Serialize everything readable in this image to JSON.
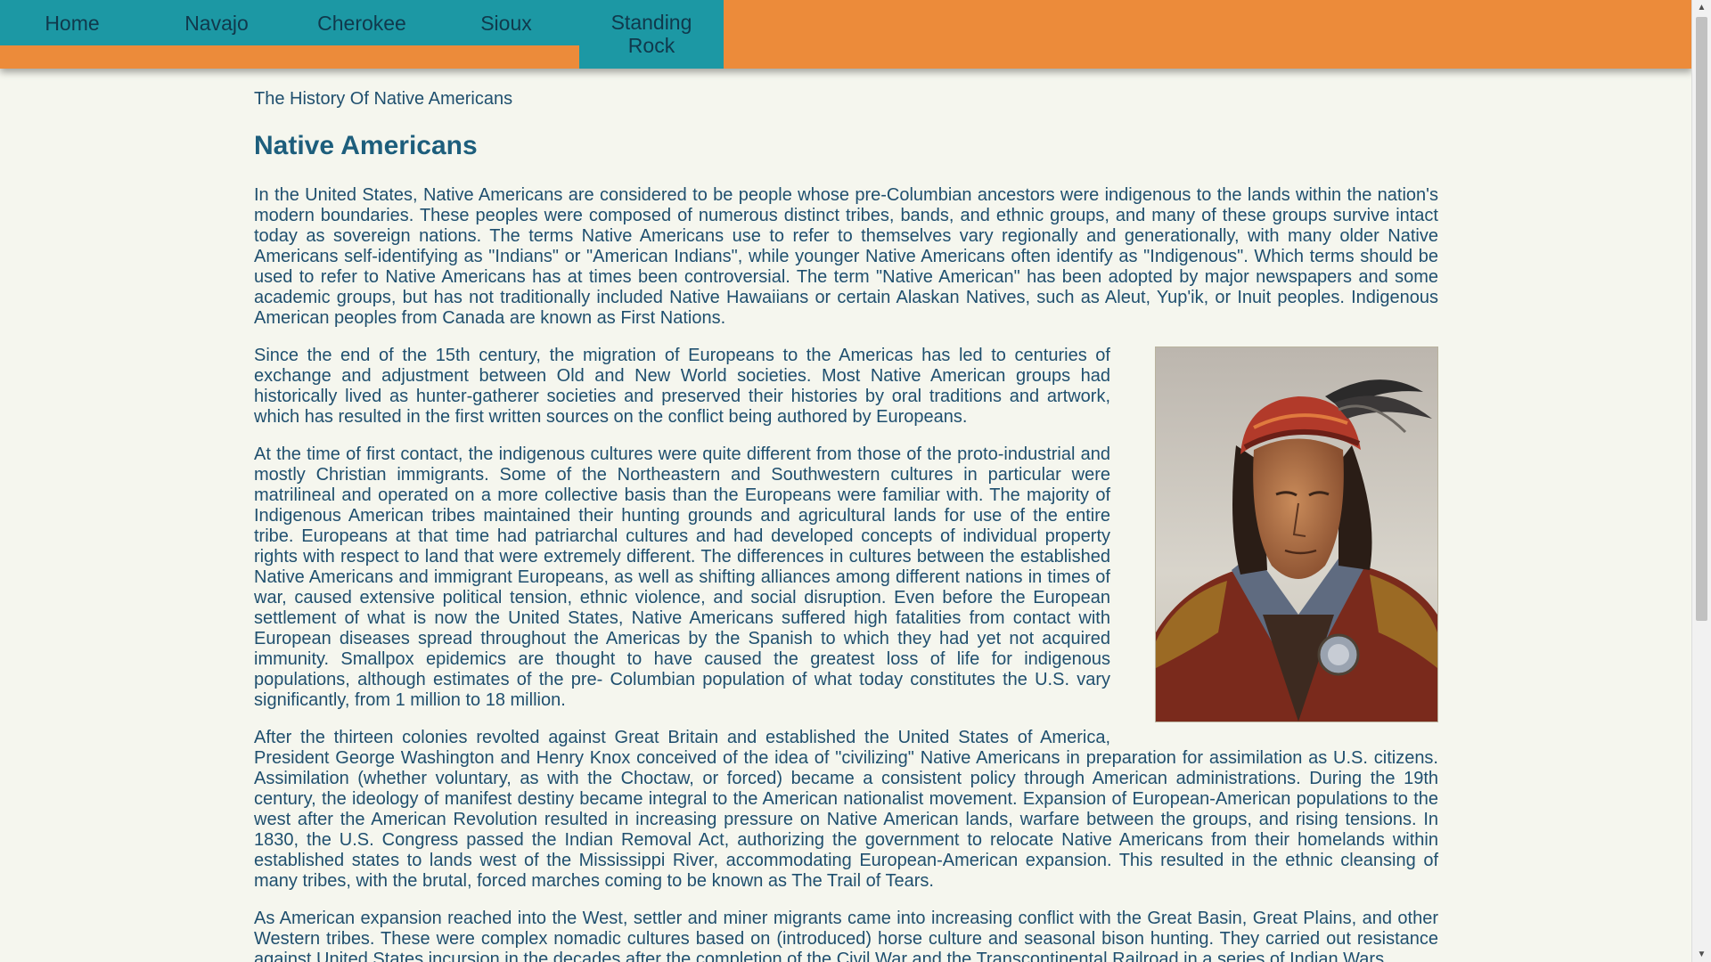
{
  "nav": {
    "items": [
      {
        "label": "Home"
      },
      {
        "label": "Navajo"
      },
      {
        "label": "Cherokee"
      },
      {
        "label": "Sioux"
      },
      {
        "label": "Standing Rock"
      }
    ]
  },
  "main": {
    "breadcrumb": "The History Of Native Americans",
    "title": "Native Americans",
    "paragraphs": [
      "In the United States, Native Americans are considered to be people whose pre-Columbian ancestors were indigenous to the lands within the nation's modern boundaries. These peoples were composed of numerous distinct tribes, bands, and ethnic groups, and many of these groups survive intact today as sovereign nations. The terms Native Americans use to refer to themselves vary regionally and generationally, with many older Native Americans self-identifying as \"Indians\" or \"American Indians\", while younger Native Americans often identify as \"Indigenous\". Which terms should be used to refer to Native Americans has at times been controversial. The term \"Native American\" has been adopted by major newspapers and some academic groups, but has not traditionally included Native Hawaiians or certain Alaskan Natives, such as Aleut, Yup'ik, or Inuit peoples. Indigenous American peoples from Canada are known as First Nations.",
      "Since the end of the 15th century, the migration of Europeans to the Americas has led to centuries of exchange and adjustment between Old and New World societies. Most Native American groups had historically lived as hunter-gatherer societies and preserved their histories by oral traditions and artwork, which has resulted in the first written sources on the conflict being authored by Europeans.",
      "At the time of first contact, the indigenous cultures were quite different from those of the proto-industrial and mostly Christian immigrants. Some of the Northeastern and Southwestern cultures in particular were matrilineal and operated on a more collective basis than the Europeans were familiar with. The majority of Indigenous American tribes maintained their hunting grounds and agricultural lands for use of the entire tribe. Europeans at that time had patriarchal cultures and had developed concepts of individual property rights with respect to land that were extremely different. The differences in cultures between the established Native Americans and immigrant Europeans, as well as shifting alliances among different nations in times of war, caused extensive political tension, ethnic violence, and social disruption. Even before the European settlement of what is now the United States, Native Americans suffered high fatalities from contact with European diseases spread throughout the Americas by the Spanish to which they had yet not acquired immunity. Smallpox epidemics are thought to have caused the greatest loss of life for indigenous populations, although estimates of the pre- Columbian population of what today constitutes the U.S. vary significantly, from 1 million to 18 million.",
      "After the thirteen colonies revolted against Great Britain and established the United States of America, President George Washington and Henry Knox conceived of the idea of \"civilizing\" Native Americans in preparation for assimilation as U.S. citizens. Assimilation (whether voluntary, as with the Choctaw, or forced) became a consistent policy through American administrations. During the 19th century, the ideology of manifest destiny became integral to the American nationalist movement. Expansion of European-American populations to the west after the American Revolution resulted in increasing pressure on Native American lands, warfare between the groups, and rising tensions. In 1830, the U.S. Congress passed the Indian Removal Act, authorizing the government to relocate Native Americans from their homelands within established states to lands west of the Mississippi River, accommodating European-American expansion. This resulted in the ethnic cleansing of many tribes, with the brutal, forced marches coming to be known as The Trail of Tears.",
      "As American expansion reached into the West, settler and miner migrants came into increasing conflict with the Great Basin, Great Plains, and other Western tribes. These were complex nomadic cultures based on (introduced) horse culture and seasonal bison hunting. They carried out resistance against United States incursion in the decades after the completion of the Civil War and the Transcontinental Railroad in a series of Indian Wars,"
    ]
  },
  "colors": {
    "nav_bar": "#ec8b3a",
    "nav_active": "#1c98a4",
    "page_background": "#f5f6ee",
    "text": "#1f4f6e",
    "title": "#1d5e7c"
  },
  "icons": {
    "scroll_up": "triangle-up",
    "scroll_down": "triangle-down"
  }
}
